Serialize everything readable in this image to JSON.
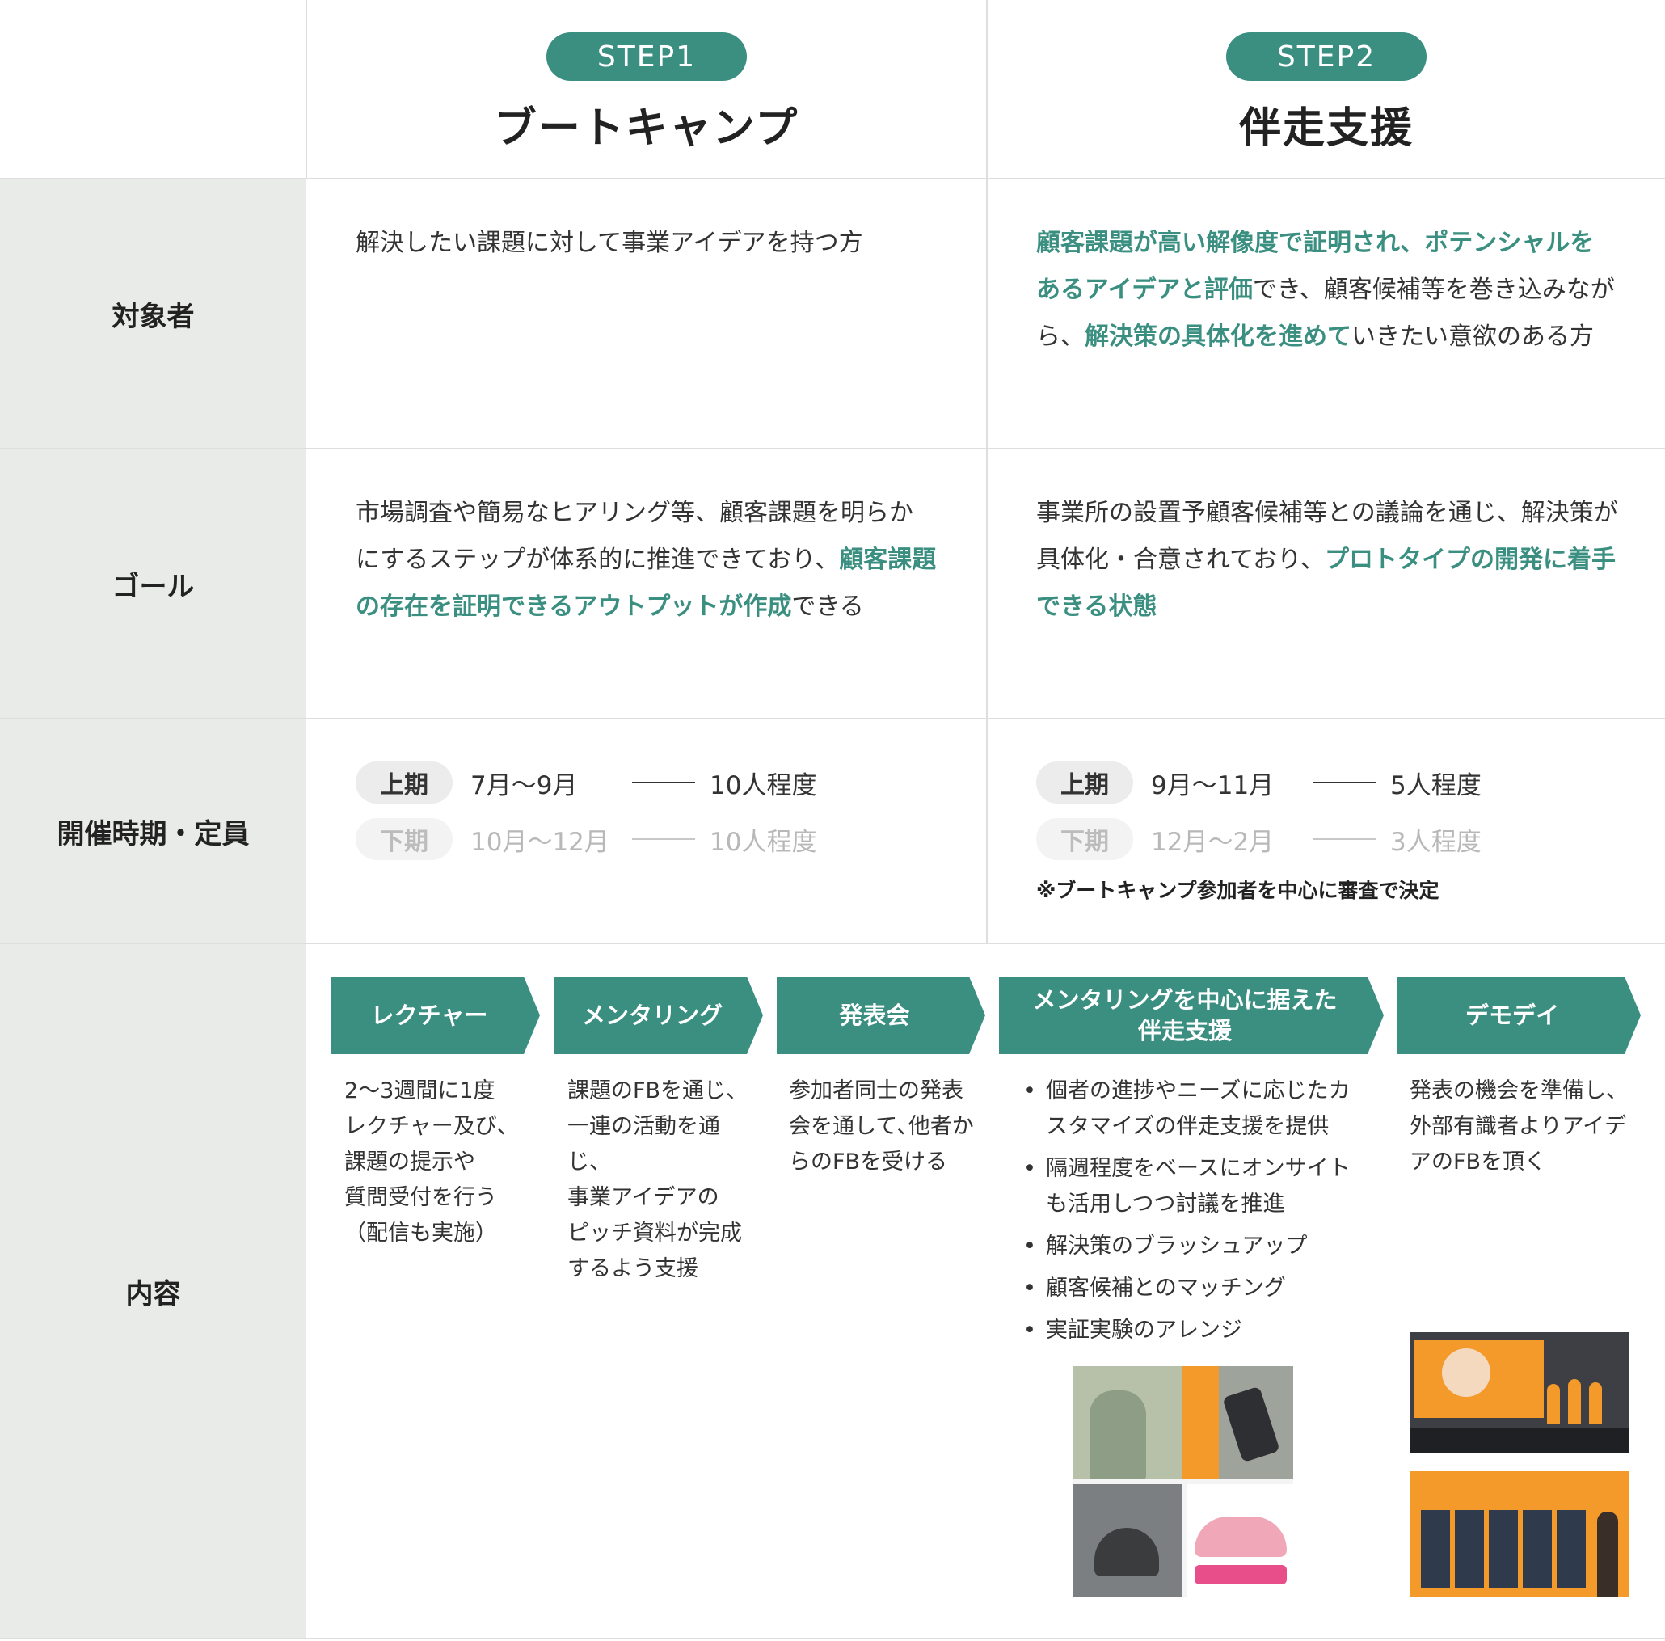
{
  "steps": [
    {
      "badge": "STEP1",
      "title": "ブートキャンプ"
    },
    {
      "badge": "STEP2",
      "title": "伴走支援"
    }
  ],
  "rows": {
    "target": "対象者",
    "goal": "ゴール",
    "schedule": "開催時期・定員",
    "content": "内容"
  },
  "target": {
    "step1": "解決したい課題に対して事業アイデアを持つ方",
    "step2": {
      "h1": "顧客課題が高い解像度で証明され、ポテンシャルをあるアイデアと評価",
      "t1": "でき、顧客候補等を巻き込みながら、",
      "h2": "解決策の具体化を進めて",
      "t2": "いきたい意欲のある方"
    }
  },
  "goal": {
    "step1": {
      "t1": "市場調査や簡易なヒアリング等、顧客課題を明らかにするステップが体系的に推進できており、",
      "h1": "顧客課題の存在を証明できるアウトプットが作成",
      "t2": "できる"
    },
    "step2": {
      "t1": "事業所の設置予顧客候補等との議論を通じ、解決策が具体化・合意されており、",
      "h1": "プロトタイプの開発に着手できる状態"
    }
  },
  "schedule": {
    "step1": [
      {
        "term": "上期",
        "period": "7月〜9月",
        "capacity": "10人程度"
      },
      {
        "term": "下期",
        "period": "10月〜12月",
        "capacity": "10人程度"
      }
    ],
    "step2": [
      {
        "term": "上期",
        "period": "9月〜11月",
        "capacity": "5人程度"
      },
      {
        "term": "下期",
        "period": "12月〜2月",
        "capacity": "3人程度"
      }
    ],
    "note": "※ブートキャンプ参加者を中心に審査で決定"
  },
  "content": {
    "arrows": [
      {
        "label": "レクチャー"
      },
      {
        "label": "メンタリング"
      },
      {
        "label": "発表会"
      },
      {
        "label1": "メンタリングを中心に据えた",
        "label2": "伴走支援"
      },
      {
        "label": "デモデイ"
      }
    ],
    "lecture_lines": [
      "2〜3週間に1度",
      "レクチャー及び、",
      "課題の提示や",
      "質問受付を行う",
      "（配信も実施）"
    ],
    "mentoring_lines": [
      "課題のFBを通じ、",
      "一連の活動を通じ、",
      "事業アイデアの",
      "ピッチ資料が完成",
      "するよう支援"
    ],
    "presentation_lines": [
      "参加者同士の発表",
      "会を通して､他者か",
      "らのFBを受ける"
    ],
    "support_bullets": [
      "個者の進捗やニーズに応じたカスタマイズの伴走支援を提供",
      "隔週程度をベースにオンサイトも活用しつつ討議を推進",
      "解決策のブラッシュアップ",
      "顧客候補とのマッチング",
      "実証実験のアレンジ"
    ],
    "demoday_lines": [
      "発表の機会を準備し、",
      "外部有識者よりアイデ",
      "アのFBを頂く"
    ]
  },
  "colors": {
    "accent": "#3a8f81",
    "label_bg": "#e9ebe8",
    "orange": "#f39a2a"
  }
}
